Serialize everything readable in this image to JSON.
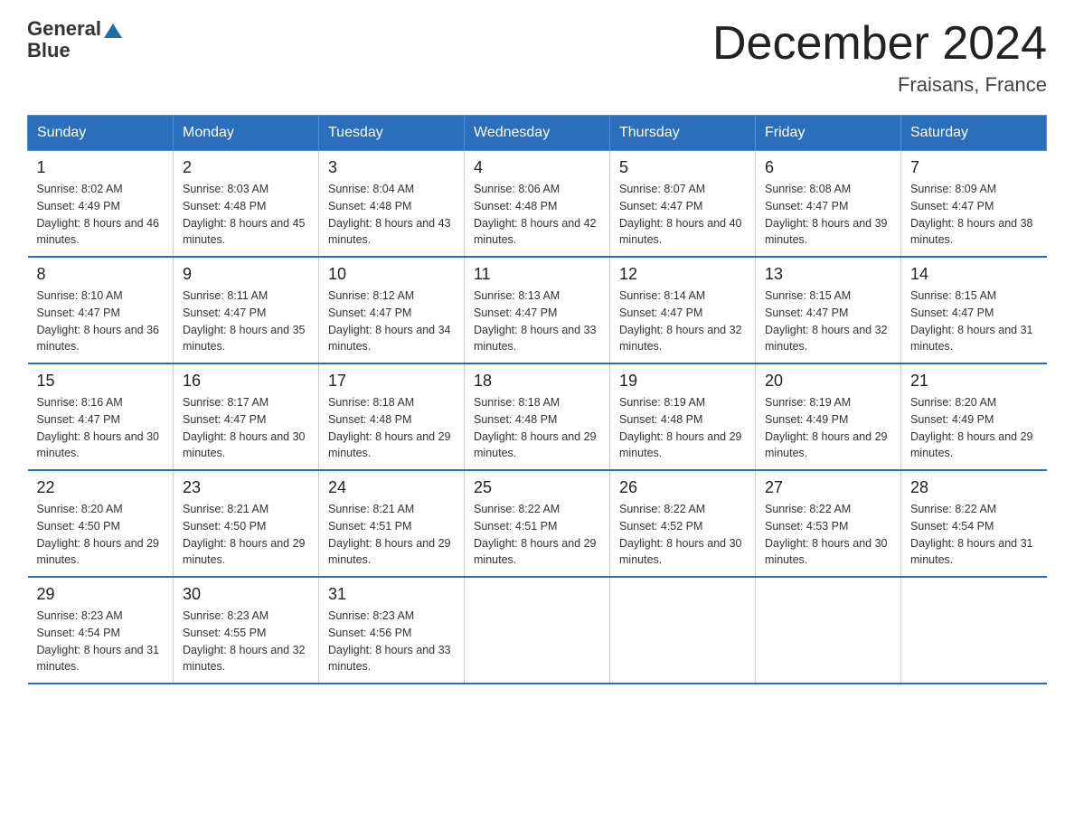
{
  "logo": {
    "line1": "General",
    "line2": "Blue"
  },
  "title": "December 2024",
  "location": "Fraisans, France",
  "days_of_week": [
    "Sunday",
    "Monday",
    "Tuesday",
    "Wednesday",
    "Thursday",
    "Friday",
    "Saturday"
  ],
  "weeks": [
    [
      {
        "num": "1",
        "sunrise": "8:02 AM",
        "sunset": "4:49 PM",
        "daylight": "8 hours and 46 minutes."
      },
      {
        "num": "2",
        "sunrise": "8:03 AM",
        "sunset": "4:48 PM",
        "daylight": "8 hours and 45 minutes."
      },
      {
        "num": "3",
        "sunrise": "8:04 AM",
        "sunset": "4:48 PM",
        "daylight": "8 hours and 43 minutes."
      },
      {
        "num": "4",
        "sunrise": "8:06 AM",
        "sunset": "4:48 PM",
        "daylight": "8 hours and 42 minutes."
      },
      {
        "num": "5",
        "sunrise": "8:07 AM",
        "sunset": "4:47 PM",
        "daylight": "8 hours and 40 minutes."
      },
      {
        "num": "6",
        "sunrise": "8:08 AM",
        "sunset": "4:47 PM",
        "daylight": "8 hours and 39 minutes."
      },
      {
        "num": "7",
        "sunrise": "8:09 AM",
        "sunset": "4:47 PM",
        "daylight": "8 hours and 38 minutes."
      }
    ],
    [
      {
        "num": "8",
        "sunrise": "8:10 AM",
        "sunset": "4:47 PM",
        "daylight": "8 hours and 36 minutes."
      },
      {
        "num": "9",
        "sunrise": "8:11 AM",
        "sunset": "4:47 PM",
        "daylight": "8 hours and 35 minutes."
      },
      {
        "num": "10",
        "sunrise": "8:12 AM",
        "sunset": "4:47 PM",
        "daylight": "8 hours and 34 minutes."
      },
      {
        "num": "11",
        "sunrise": "8:13 AM",
        "sunset": "4:47 PM",
        "daylight": "8 hours and 33 minutes."
      },
      {
        "num": "12",
        "sunrise": "8:14 AM",
        "sunset": "4:47 PM",
        "daylight": "8 hours and 32 minutes."
      },
      {
        "num": "13",
        "sunrise": "8:15 AM",
        "sunset": "4:47 PM",
        "daylight": "8 hours and 32 minutes."
      },
      {
        "num": "14",
        "sunrise": "8:15 AM",
        "sunset": "4:47 PM",
        "daylight": "8 hours and 31 minutes."
      }
    ],
    [
      {
        "num": "15",
        "sunrise": "8:16 AM",
        "sunset": "4:47 PM",
        "daylight": "8 hours and 30 minutes."
      },
      {
        "num": "16",
        "sunrise": "8:17 AM",
        "sunset": "4:47 PM",
        "daylight": "8 hours and 30 minutes."
      },
      {
        "num": "17",
        "sunrise": "8:18 AM",
        "sunset": "4:48 PM",
        "daylight": "8 hours and 29 minutes."
      },
      {
        "num": "18",
        "sunrise": "8:18 AM",
        "sunset": "4:48 PM",
        "daylight": "8 hours and 29 minutes."
      },
      {
        "num": "19",
        "sunrise": "8:19 AM",
        "sunset": "4:48 PM",
        "daylight": "8 hours and 29 minutes."
      },
      {
        "num": "20",
        "sunrise": "8:19 AM",
        "sunset": "4:49 PM",
        "daylight": "8 hours and 29 minutes."
      },
      {
        "num": "21",
        "sunrise": "8:20 AM",
        "sunset": "4:49 PM",
        "daylight": "8 hours and 29 minutes."
      }
    ],
    [
      {
        "num": "22",
        "sunrise": "8:20 AM",
        "sunset": "4:50 PM",
        "daylight": "8 hours and 29 minutes."
      },
      {
        "num": "23",
        "sunrise": "8:21 AM",
        "sunset": "4:50 PM",
        "daylight": "8 hours and 29 minutes."
      },
      {
        "num": "24",
        "sunrise": "8:21 AM",
        "sunset": "4:51 PM",
        "daylight": "8 hours and 29 minutes."
      },
      {
        "num": "25",
        "sunrise": "8:22 AM",
        "sunset": "4:51 PM",
        "daylight": "8 hours and 29 minutes."
      },
      {
        "num": "26",
        "sunrise": "8:22 AM",
        "sunset": "4:52 PM",
        "daylight": "8 hours and 30 minutes."
      },
      {
        "num": "27",
        "sunrise": "8:22 AM",
        "sunset": "4:53 PM",
        "daylight": "8 hours and 30 minutes."
      },
      {
        "num": "28",
        "sunrise": "8:22 AM",
        "sunset": "4:54 PM",
        "daylight": "8 hours and 31 minutes."
      }
    ],
    [
      {
        "num": "29",
        "sunrise": "8:23 AM",
        "sunset": "4:54 PM",
        "daylight": "8 hours and 31 minutes."
      },
      {
        "num": "30",
        "sunrise": "8:23 AM",
        "sunset": "4:55 PM",
        "daylight": "8 hours and 32 minutes."
      },
      {
        "num": "31",
        "sunrise": "8:23 AM",
        "sunset": "4:56 PM",
        "daylight": "8 hours and 33 minutes."
      },
      null,
      null,
      null,
      null
    ]
  ]
}
